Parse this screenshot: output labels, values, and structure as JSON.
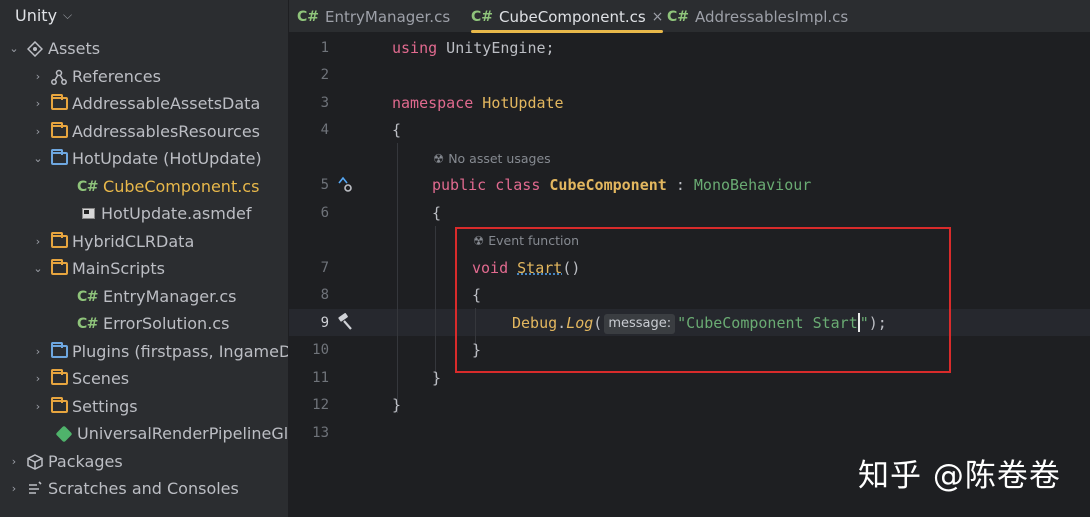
{
  "project": {
    "name": "Unity",
    "dropdown_icon": "chevron-down-icon"
  },
  "tree": [
    {
      "label": "Assets",
      "icon": "assets-icon",
      "arrow": "expanded"
    },
    {
      "label": "References",
      "icon": "references-icon",
      "arrow": "collapsed"
    },
    {
      "label": "AddressableAssetsData",
      "icon": "folder-icon",
      "arrow": "collapsed"
    },
    {
      "label": "AddressablesResources",
      "icon": "folder-icon",
      "arrow": "collapsed"
    },
    {
      "label": "HotUpdate (HotUpdate)",
      "icon": "assembly-folder-icon",
      "arrow": "expanded"
    },
    {
      "label": "CubeComponent.cs",
      "icon": "csharp-file-icon",
      "badge": "C#",
      "selected": true
    },
    {
      "label": "HotUpdate.asmdef",
      "icon": "asmdef-file-icon"
    },
    {
      "label": "HybridCLRData",
      "icon": "folder-icon",
      "arrow": "collapsed"
    },
    {
      "label": "MainScripts",
      "icon": "folder-icon",
      "arrow": "expanded"
    },
    {
      "label": "EntryManager.cs",
      "icon": "csharp-file-icon",
      "badge": "C#"
    },
    {
      "label": "ErrorSolution.cs",
      "icon": "csharp-file-icon",
      "badge": "C#"
    },
    {
      "label": "Plugins (firstpass, IngameD",
      "icon": "assembly-folder-icon",
      "arrow": "collapsed"
    },
    {
      "label": "Scenes",
      "icon": "folder-icon",
      "arrow": "collapsed"
    },
    {
      "label": "Settings",
      "icon": "folder-icon",
      "arrow": "collapsed"
    },
    {
      "label": "UniversalRenderPipelineGlo",
      "icon": "asset-gem-icon"
    },
    {
      "label": "Packages",
      "icon": "packages-icon",
      "arrow": "collapsed"
    },
    {
      "label": "Scratches and Consoles",
      "icon": "scratches-icon",
      "arrow": "collapsed"
    }
  ],
  "tabs": [
    {
      "badge": "C#",
      "label": "EntryManager.cs"
    },
    {
      "badge": "C#",
      "label": "CubeComponent.cs",
      "active": true,
      "close": "×"
    },
    {
      "badge": "C#",
      "label": "AddressablesImpl.cs"
    }
  ],
  "editor": {
    "line_numbers": [
      "1",
      "2",
      "3",
      "4",
      "5",
      "6",
      "7",
      "8",
      "9",
      "10",
      "11",
      "12",
      "13"
    ],
    "current_line": "9",
    "code": {
      "l1_kw": "using",
      "l1_rest": " UnityEngine;",
      "l3_kw": "namespace",
      "l3_name": " HotUpdate",
      "l4": "{",
      "hint_class": "No asset usages",
      "l5_public": "public",
      "l5_class": " class ",
      "l5_name": "CubeComponent",
      "l5_colon": " : ",
      "l5_base": "MonoBehaviour",
      "l6": "{",
      "hint_method": "Event function",
      "l7_void": "void ",
      "l7_name": "Start",
      "l7_parens": "()",
      "l8": "{",
      "l9_debug": "Debug",
      "l9_dot": ".",
      "l9_log": "Log",
      "l9_open": "(",
      "l9_param_hint": "message:",
      "l9_str_a": "\"CubeComponent Start",
      "l9_str_b": "\"",
      "l9_close": ");",
      "l10": "}",
      "l11": "}",
      "l12": "}"
    }
  },
  "watermark": "知乎 @陈卷卷"
}
